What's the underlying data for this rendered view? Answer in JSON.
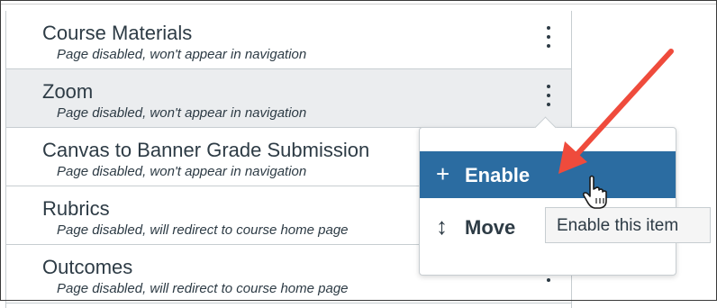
{
  "list": {
    "items": [
      {
        "title": "Course Materials",
        "subtitle": "Page disabled, won't appear in navigation",
        "highlighted": false
      },
      {
        "title": "Zoom",
        "subtitle": "Page disabled, won't appear in navigation",
        "highlighted": true
      },
      {
        "title": "Canvas to Banner Grade Submission",
        "subtitle": "Page disabled, won't appear in navigation",
        "highlighted": false
      },
      {
        "title": "Rubrics",
        "subtitle": "Page disabled, will redirect to course home page",
        "highlighted": false
      },
      {
        "title": "Outcomes",
        "subtitle": "Page disabled, will redirect to course home page",
        "highlighted": false
      }
    ]
  },
  "menu": {
    "enable": {
      "glyph": "+",
      "label": "Enable"
    },
    "move": {
      "glyph": "↕",
      "label": "Move"
    }
  },
  "tooltip": {
    "text": "Enable this item"
  },
  "colors": {
    "accent": "#2b6ca1",
    "annotation_arrow": "#ef4b3c",
    "row_highlight": "#ebedef",
    "text": "#2d3b45"
  },
  "icons": {
    "kebab": "more-vertical-icon",
    "cursor": "hand-pointer-icon"
  }
}
